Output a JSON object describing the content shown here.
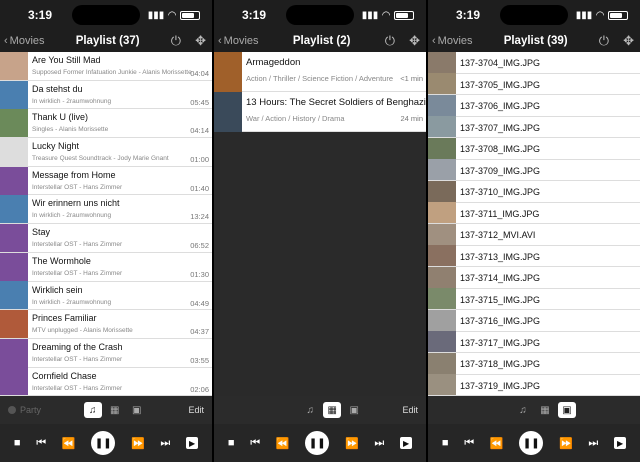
{
  "status": {
    "time": "3:19"
  },
  "screens": [
    {
      "back_label": "Movies",
      "title": "Playlist (37)",
      "items": [
        {
          "title": "Are You Still Mad",
          "subtitle": "Supposed Former Infatuation Junkie - Alanis Morissette",
          "duration": "04:04",
          "thumb": "#c7a38a"
        },
        {
          "title": "Da stehst du",
          "subtitle": "In wirklich - 2raumwohnung",
          "duration": "05:45",
          "thumb": "#4a7fb0"
        },
        {
          "title": "Thank U (live)",
          "subtitle": "Singles - Alanis Morissette",
          "duration": "04:14",
          "thumb": "#6b8a5a"
        },
        {
          "title": "Lucky Night",
          "subtitle": "Treasure Quest Soundtrack - Jody Marie Gnant",
          "duration": "01:00",
          "thumb": "#dddddd"
        },
        {
          "title": "Message from Home",
          "subtitle": "Interstellar OST - Hans Zimmer",
          "duration": "01:40",
          "thumb": "#7a4d9a"
        },
        {
          "title": "Wir erinnern uns nicht",
          "subtitle": "In wirklich - 2raumwohnung",
          "duration": "13:24",
          "thumb": "#4a7fb0"
        },
        {
          "title": "Stay",
          "subtitle": "Interstellar OST - Hans Zimmer",
          "duration": "06:52",
          "thumb": "#7a4d9a"
        },
        {
          "title": "The Wormhole",
          "subtitle": "Interstellar OST - Hans Zimmer",
          "duration": "01:30",
          "thumb": "#7a4d9a"
        },
        {
          "title": "Wirklich sein",
          "subtitle": "In wirklich - 2raumwohnung",
          "duration": "04:49",
          "thumb": "#4a7fb0"
        },
        {
          "title": "Princes Familiar",
          "subtitle": "MTV unplugged - Alanis Morissette",
          "duration": "04:37",
          "thumb": "#b05a3a"
        },
        {
          "title": "Dreaming of the Crash",
          "subtitle": "Interstellar OST - Hans Zimmer",
          "duration": "03:55",
          "thumb": "#7a4d9a"
        },
        {
          "title": "Cornfield Chase",
          "subtitle": "Interstellar OST - Hans Zimmer",
          "duration": "02:06",
          "thumb": "#7a4d9a"
        }
      ],
      "party_label": "Party",
      "edit_label": "Edit",
      "active_mode": 0
    },
    {
      "back_label": "Movies",
      "title": "Playlist (2)",
      "items": [
        {
          "title": "Armageddon",
          "subtitle": "Action / Thriller / Science Fiction / Adventure",
          "duration": "<1 min",
          "thumb": "#a0602a"
        },
        {
          "title": "13 Hours: The Secret Soldiers of Benghazi",
          "subtitle": "War / Action / History / Drama",
          "duration": "24 min",
          "thumb": "#3a4a5a"
        }
      ],
      "edit_label": "Edit",
      "active_mode": 1
    },
    {
      "back_label": "Movies",
      "title": "Playlist (39)",
      "items": [
        {
          "title": "137-3704_IMG.JPG",
          "thumb": "#8a7a6a"
        },
        {
          "title": "137-3705_IMG.JPG",
          "thumb": "#9a8a70"
        },
        {
          "title": "137-3706_IMG.JPG",
          "thumb": "#7a8a9a"
        },
        {
          "title": "137-3707_IMG.JPG",
          "thumb": "#8a9aa0"
        },
        {
          "title": "137-3708_IMG.JPG",
          "thumb": "#6a7a5a"
        },
        {
          "title": "137-3709_IMG.JPG",
          "thumb": "#9aa0a8"
        },
        {
          "title": "137-3710_IMG.JPG",
          "thumb": "#7a6a5a"
        },
        {
          "title": "137-3711_IMG.JPG",
          "thumb": "#c0a080"
        },
        {
          "title": "137-3712_MVI.AVI",
          "thumb": "#a09080"
        },
        {
          "title": "137-3713_IMG.JPG",
          "thumb": "#8a7060"
        },
        {
          "title": "137-3714_IMG.JPG",
          "thumb": "#908070"
        },
        {
          "title": "137-3715_IMG.JPG",
          "thumb": "#7a8a6a"
        },
        {
          "title": "137-3716_IMG.JPG",
          "thumb": "#a0a0a0"
        },
        {
          "title": "137-3717_IMG.JPG",
          "thumb": "#6a6a7a"
        },
        {
          "title": "137-3718_IMG.JPG",
          "thumb": "#8a8070"
        },
        {
          "title": "137-3719_IMG.JPG",
          "thumb": "#9a9080"
        }
      ],
      "active_mode": 2
    }
  ],
  "modes": [
    "music-note-icon",
    "film-icon",
    "image-icon"
  ],
  "mode_glyphs": [
    "♫",
    "▦",
    "▣"
  ],
  "controls": [
    {
      "name": "stop-button",
      "glyph": "■"
    },
    {
      "name": "previous-button",
      "glyph": "⏮"
    },
    {
      "name": "rewind-button",
      "glyph": "⏪"
    },
    {
      "name": "play-pause-button",
      "glyph": "❚❚"
    },
    {
      "name": "fast-forward-button",
      "glyph": "⏩"
    },
    {
      "name": "next-button",
      "glyph": "⏭"
    },
    {
      "name": "play-button",
      "glyph": "▶"
    }
  ]
}
